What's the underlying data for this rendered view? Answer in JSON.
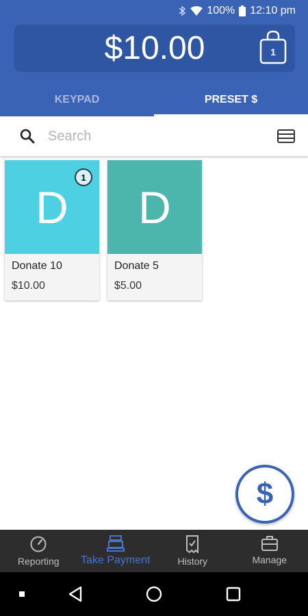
{
  "status_bar": {
    "battery": "100%",
    "time": "12:10 pm",
    "icons": [
      "bluetooth-icon",
      "wifi-icon",
      "battery-icon"
    ]
  },
  "header": {
    "amount": "$10.00",
    "cart_count": "1",
    "tabs": [
      {
        "label": "KEYPAD",
        "active": false
      },
      {
        "label": "PRESET $",
        "active": true
      }
    ]
  },
  "search": {
    "placeholder": "Search",
    "value": ""
  },
  "products": [
    {
      "initial": "D",
      "name": "Donate 10",
      "price": "$10.00",
      "quantity": "1",
      "color": "#4dd0e1"
    },
    {
      "initial": "D",
      "name": "Donate 5",
      "price": "$5.00",
      "color": "#4db6ac"
    }
  ],
  "fab": {
    "symbol": "$",
    "icon": "dollar-icon"
  },
  "bottom_nav": {
    "items": [
      {
        "label": "Reporting",
        "icon": "gauge-icon",
        "active": false
      },
      {
        "label": "Take Payment",
        "icon": "register-icon",
        "active": true
      },
      {
        "label": "History",
        "icon": "receipt-icon",
        "active": false
      },
      {
        "label": "Manage",
        "icon": "briefcase-icon",
        "active": false
      }
    ]
  },
  "android_nav": {
    "icons": [
      "recents-dot-icon",
      "back-icon",
      "home-icon",
      "overview-icon"
    ]
  },
  "colors": {
    "brand": "#3a63b5",
    "brand_dark": "#2f56a3",
    "nav_bg": "#2d2d2d",
    "active_nav": "#4a74c9"
  }
}
